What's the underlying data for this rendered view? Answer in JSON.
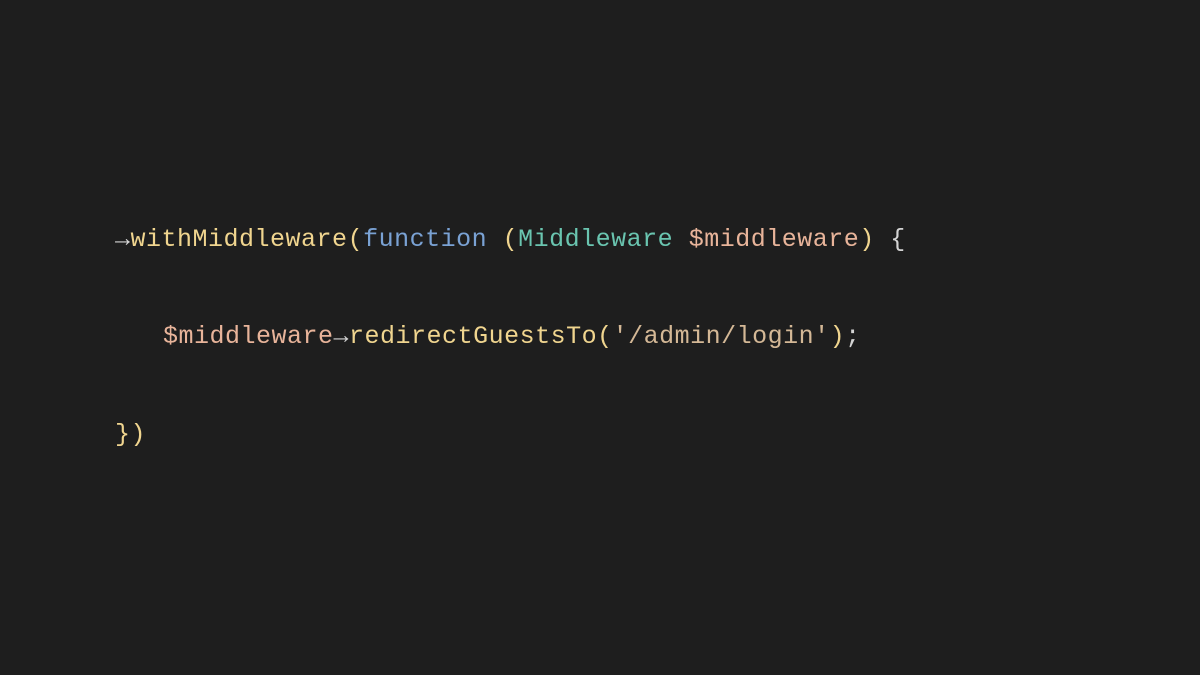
{
  "code": {
    "line1": {
      "arrow": "→",
      "method": "withMiddleware",
      "openParen": "(",
      "keyword": "function",
      "space": " ",
      "openParen2": "(",
      "type": "Middleware",
      "variable": "$middleware",
      "closeParen": ")",
      "openBrace": " {"
    },
    "line2": {
      "variable": "$middleware",
      "arrow": "→",
      "method": "redirectGuestsTo",
      "openParen": "(",
      "string": "'/admin/login'",
      "closeParen": ")",
      "semicolon": ";"
    },
    "line3": {
      "closeBrace": "}",
      "closeParen": ")"
    }
  }
}
